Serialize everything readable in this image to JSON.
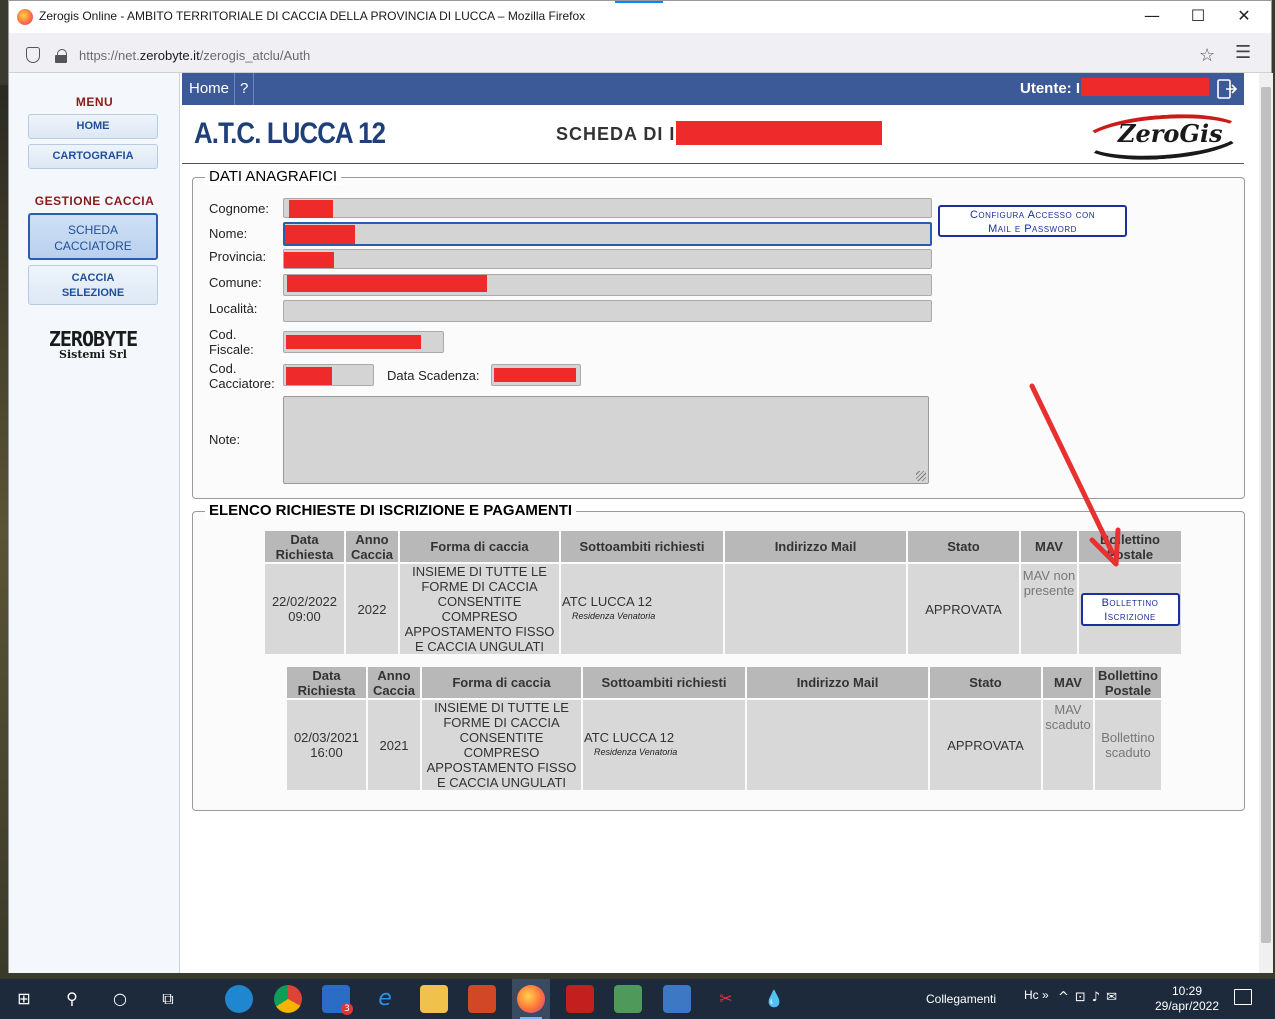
{
  "browser": {
    "window_title": "Zerogis Online - AMBITO TERRITORIALE DI CACCIA DELLA PROVINCIA DI LUCCA – Mozilla Firefox",
    "url_prefix": "https://net.",
    "url_domain": "zerobyte.it",
    "url_path": "/zerogis_atclu/Auth",
    "minimize": "—",
    "maximize": "☐",
    "close": "✕"
  },
  "sidebar": {
    "menu_heading": "MENU",
    "menu_items": [
      "HOME",
      "CARTOGRAFIA"
    ],
    "section_heading": "GESTIONE CACCIA",
    "section_items": [
      {
        "line1": "SCHEDA",
        "line2": "CACCIATORE",
        "active": true
      },
      {
        "line1": "CACCIA",
        "line2": "SELEZIONE",
        "active": false
      }
    ],
    "logo_big": "ZEROBYTE",
    "logo_small": "Sistemi Srl"
  },
  "topnav": {
    "home": "Home",
    "help": "?",
    "utente_label": "Utente:",
    "utente_prefix": "I"
  },
  "header": {
    "atc_title": "A.T.C. LUCCA 12",
    "scheda_label": "SCHEDA DI",
    "scheda_prefix": "I",
    "brand_logo": "ZeroGis"
  },
  "anagrafica": {
    "legend": "DATI ANAGRAFICI",
    "labels": {
      "cognome": "Cognome:",
      "nome": "Nome:",
      "provincia": "Provincia:",
      "comune": "Comune:",
      "localita": "Località:",
      "cod_fiscale_1": "Cod.",
      "cod_fiscale_2": "Fiscale:",
      "cod_cacciatore_1": "Cod.",
      "cod_cacciatore_2": "Cacciatore:",
      "data_scadenza": "Data Scadenza:",
      "note": "Note:"
    },
    "config_button_line1": "Configura Accesso con",
    "config_button_line2": "Mail e Password"
  },
  "richieste": {
    "legend": "ELENCO RICHIESTE DI ISCRIZIONE E PAGAMENTI",
    "columns": [
      "Data Richiesta",
      "Anno Caccia",
      "Forma di caccia",
      "Sottoambiti richiesti",
      "Indirizzo Mail",
      "Stato",
      "MAV",
      "Bollettino Postale"
    ],
    "rows": [
      {
        "data": "22/02/2022",
        "ora": "09:00",
        "anno": "2022",
        "forma": "INSIEME DI TUTTE LE FORME DI CACCIA CONSENTITE COMPRESO APPOSTAMENTO FISSO E CACCIA UNGULATI",
        "sottoambito": "ATC LUCCA 12",
        "residenza": "Residenza Venatoria",
        "mail": "",
        "stato": "APPROVATA",
        "mav": "MAV non presente",
        "bollettino_btn_line1": "Bollettino",
        "bollettino_btn_line2": "Iscrizione"
      },
      {
        "data": "02/03/2021",
        "ora": "16:00",
        "anno": "2021",
        "forma": "INSIEME DI TUTTE LE FORME DI CACCIA CONSENTITE COMPRESO APPOSTAMENTO FISSO E CACCIA UNGULATI",
        "sottoambito": "ATC LUCCA 12",
        "residenza": "Residenza Venatoria",
        "mail": "",
        "stato": "APPROVATA",
        "mav": "MAV scaduto",
        "bollettino": "Bollettino scaduto"
      }
    ]
  },
  "taskbar": {
    "collegamenti": "Collegamenti",
    "weather_label": "Hc",
    "time": "10:29",
    "date": "29/apr/2022",
    "mail_badge": "3"
  },
  "colors": {
    "nav_blue": "#3d5a98",
    "redaction": "#ee2a2a",
    "button_border": "#1c2f9a",
    "menu_heading": "#8b1a1a"
  }
}
